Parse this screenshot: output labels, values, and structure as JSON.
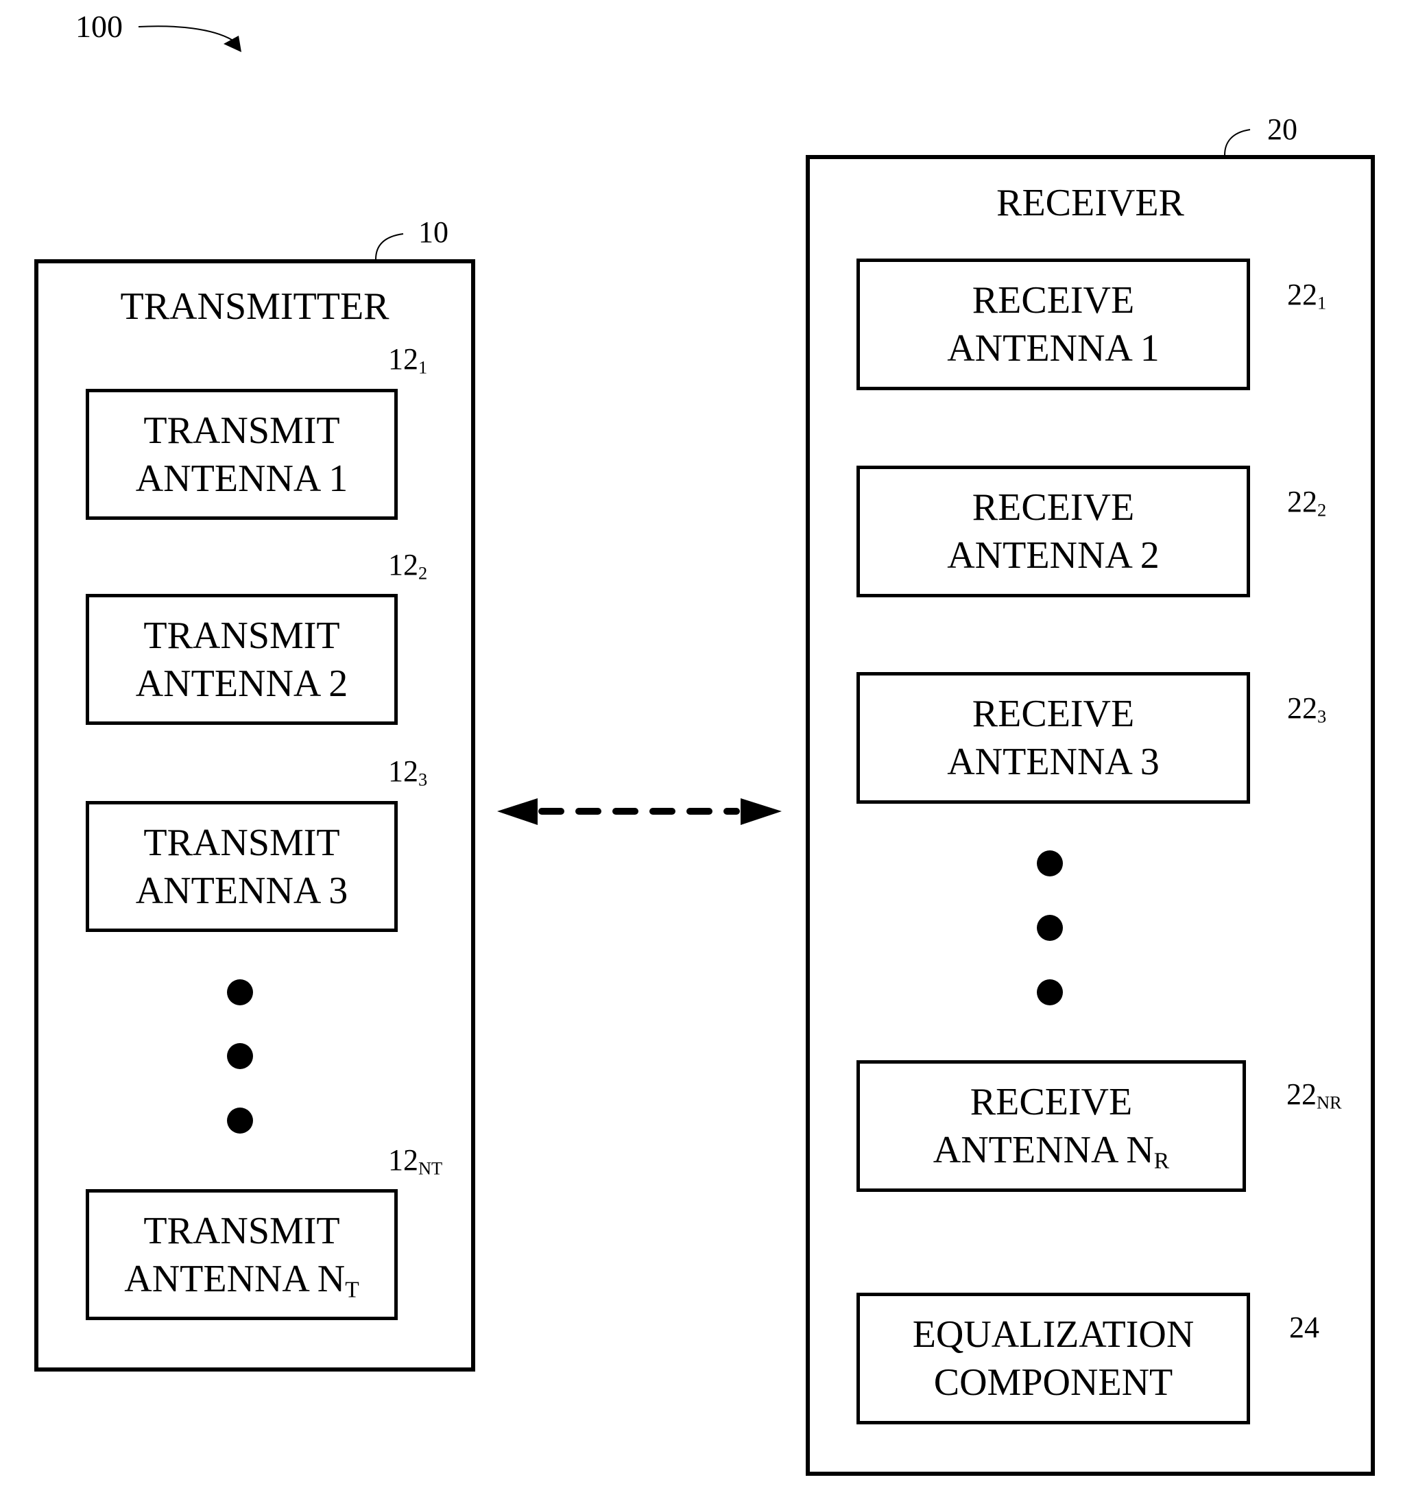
{
  "figure": {
    "ref_label": "100"
  },
  "transmitter": {
    "title": "TRANSMITTER",
    "ref": "10",
    "antennas": [
      {
        "line1": "TRANSMIT",
        "line2": "ANTENNA 1",
        "line2_sub": "",
        "ref": "12",
        "ref_sub": "1"
      },
      {
        "line1": "TRANSMIT",
        "line2": "ANTENNA 2",
        "line2_sub": "",
        "ref": "12",
        "ref_sub": "2"
      },
      {
        "line1": "TRANSMIT",
        "line2": "ANTENNA 3",
        "line2_sub": "",
        "ref": "12",
        "ref_sub": "3"
      },
      {
        "line1": "TRANSMIT",
        "line2": "ANTENNA N",
        "line2_sub": "T",
        "ref": "12",
        "ref_sub": "NT"
      }
    ],
    "ellipsis_dots": 3
  },
  "link": {
    "type": "bidirectional-dashed-arrow"
  },
  "receiver": {
    "title": "RECEIVER",
    "ref": "20",
    "antennas": [
      {
        "line1": "RECEIVE",
        "line2": "ANTENNA 1",
        "line2_sub": "",
        "ref": "22",
        "ref_sub": "1"
      },
      {
        "line1": "RECEIVE",
        "line2": "ANTENNA 2",
        "line2_sub": "",
        "ref": "22",
        "ref_sub": "2"
      },
      {
        "line1": "RECEIVE",
        "line2": "ANTENNA 3",
        "line2_sub": "",
        "ref": "22",
        "ref_sub": "3"
      },
      {
        "line1": "RECEIVE",
        "line2": "ANTENNA N",
        "line2_sub": "R",
        "ref": "22",
        "ref_sub": "NR"
      }
    ],
    "ellipsis_dots": 3,
    "equalizer": {
      "line1": "EQUALIZATION",
      "line2": "COMPONENT",
      "ref": "24"
    }
  }
}
